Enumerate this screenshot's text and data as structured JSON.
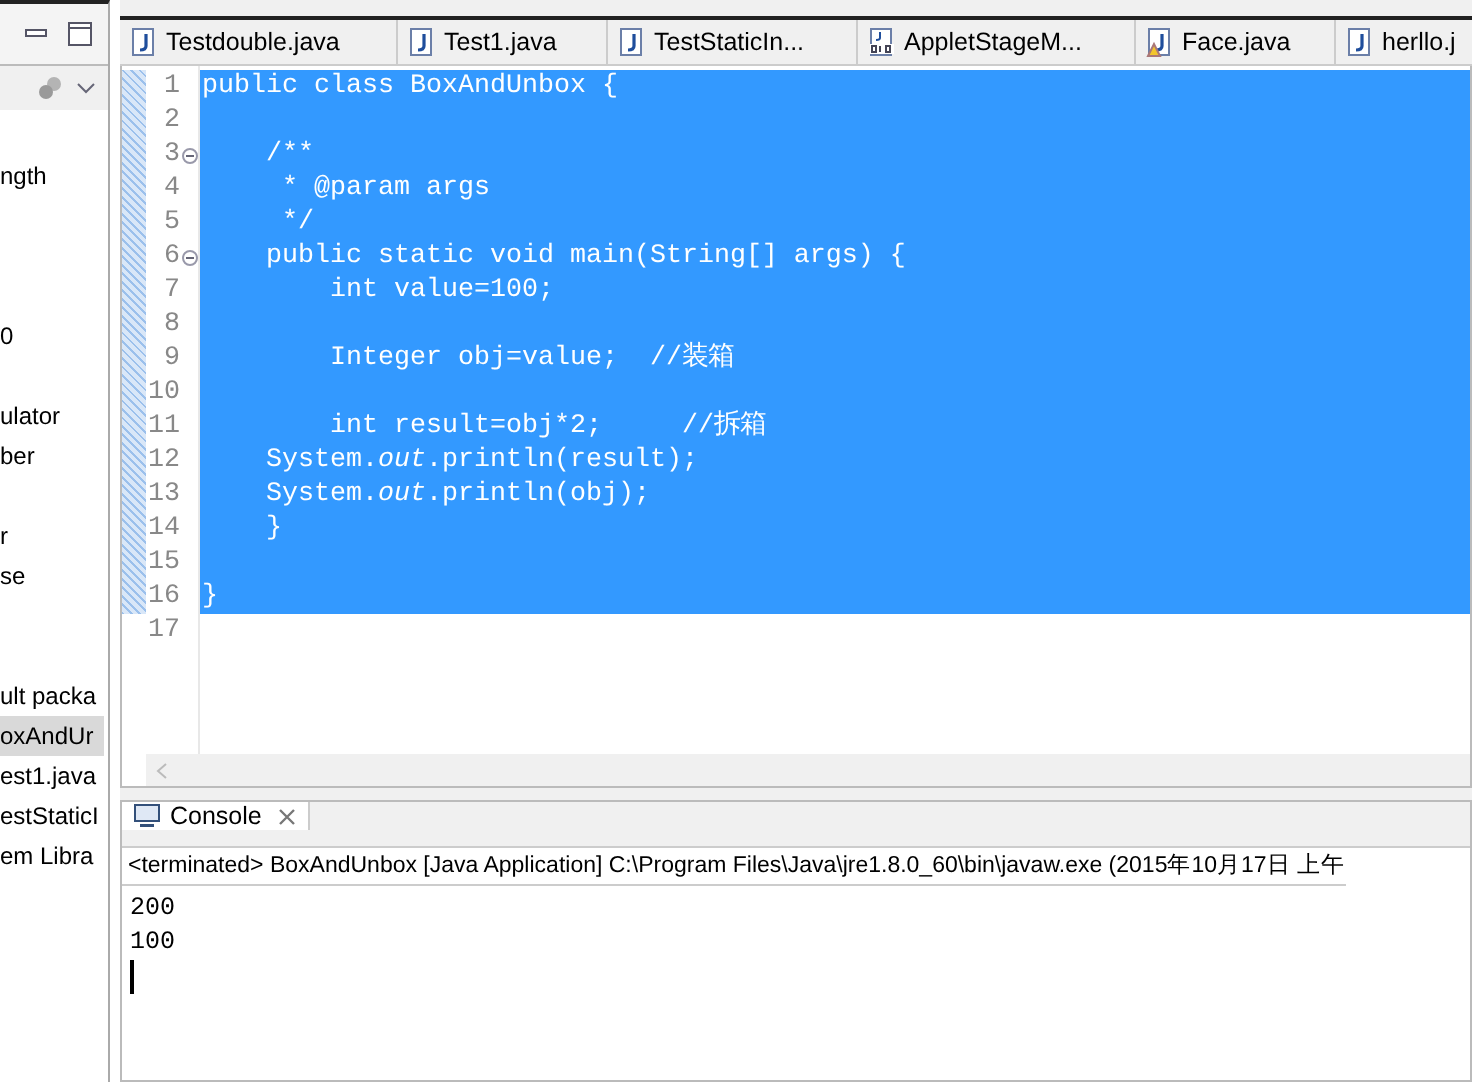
{
  "sidebar": {
    "items": [
      {
        "kind": "blank"
      },
      {
        "kind": "item",
        "label": "ngth",
        "selected": false
      },
      {
        "kind": "blank"
      },
      {
        "kind": "blank"
      },
      {
        "kind": "blank"
      },
      {
        "kind": "item",
        "label": "0",
        "selected": false
      },
      {
        "kind": "blank"
      },
      {
        "kind": "item",
        "label": "ulator",
        "selected": false
      },
      {
        "kind": "item",
        "label": "ber",
        "selected": false
      },
      {
        "kind": "blank"
      },
      {
        "kind": "item",
        "label": "r",
        "selected": false
      },
      {
        "kind": "item",
        "label": "se",
        "selected": false
      },
      {
        "kind": "blank"
      },
      {
        "kind": "blank"
      },
      {
        "kind": "item",
        "label": "ult packa",
        "selected": false
      },
      {
        "kind": "item",
        "label": "oxAndUr",
        "selected": true
      },
      {
        "kind": "item",
        "label": "est1.java",
        "selected": false
      },
      {
        "kind": "item",
        "label": "estStaticI",
        "selected": false
      },
      {
        "kind": "item",
        "label": "em Libra",
        "selected": false
      }
    ]
  },
  "editor_tabs": [
    {
      "label": "Testdouble.java",
      "kind": "java",
      "warning": false,
      "selected": false
    },
    {
      "label": "Test1.java",
      "kind": "java",
      "warning": false,
      "selected": false
    },
    {
      "label": "TestStaticIn...",
      "kind": "java",
      "warning": false,
      "selected": false
    },
    {
      "label": "AppletStageM...",
      "kind": "class",
      "warning": false,
      "selected": false
    },
    {
      "label": "Face.java",
      "kind": "java",
      "warning": true,
      "selected": false
    },
    {
      "label": "herllo.j",
      "kind": "java",
      "warning": false,
      "selected": false
    }
  ],
  "code_lines": [
    {
      "number": "1",
      "text": "public class BoxAndUnbox {",
      "fold": false,
      "selected": true
    },
    {
      "number": "2",
      "fold": false,
      "selected": true
    },
    {
      "number": "3",
      "text": "    /**",
      "fold": true,
      "selected": true
    },
    {
      "number": "4",
      "text": "     * @param args",
      "fold": false,
      "selected": true
    },
    {
      "number": "5",
      "text": "     */",
      "fold": false,
      "selected": true
    },
    {
      "number": "6",
      "text": "    public static void main(String[] args) {",
      "fold": true,
      "selected": true
    },
    {
      "number": "7",
      "text": "        int value=100;",
      "fold": false,
      "selected": true
    },
    {
      "number": "8",
      "fold": false,
      "selected": true
    },
    {
      "number": "9",
      "text": "        Integer obj=value;  //装箱",
      "fold": false,
      "selected": true
    },
    {
      "number": "10",
      "fold": false,
      "selected": true
    },
    {
      "number": "11",
      "text": "        int result=obj*2;     //拆箱",
      "fold": false,
      "selected": true
    },
    {
      "number": "12",
      "text": "    System.*out*.println(result);",
      "fold": false,
      "selected": true
    },
    {
      "number": "13",
      "text": "    System.*out*.println(obj);",
      "fold": false,
      "selected": true
    },
    {
      "number": "14",
      "text": "    }",
      "fold": false,
      "selected": true
    },
    {
      "number": "15",
      "fold": false,
      "selected": true
    },
    {
      "number": "16",
      "text": "}",
      "fold": false,
      "selected": true
    },
    {
      "number": "17",
      "fold": false,
      "selected": false
    }
  ],
  "console": {
    "tab": {
      "label": "Console",
      "selected": true
    },
    "header": "<terminated> BoxAndUnbox [Java Application] C:\\Program Files\\Java\\jre1.8.0_60\\bin\\javaw.exe (2015年10月17日 上午",
    "output": [
      "200",
      "100"
    ]
  }
}
